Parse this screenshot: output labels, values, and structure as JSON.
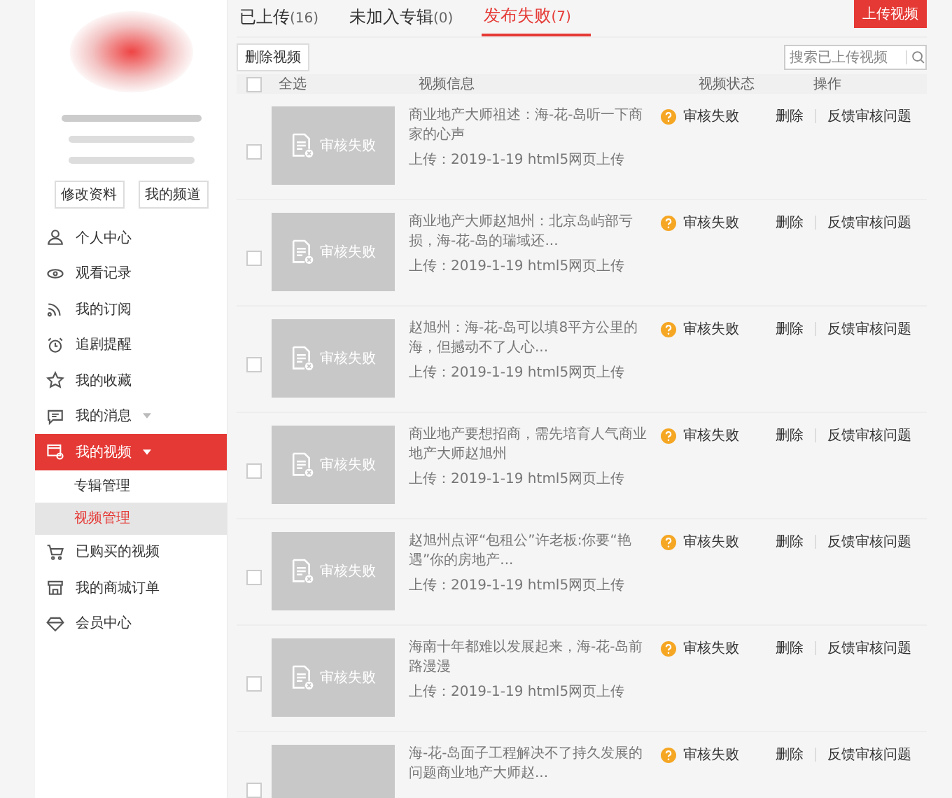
{
  "sidebar": {
    "buttons": [
      "修改资料",
      "我的频道"
    ],
    "items": [
      {
        "kind": "user",
        "label": "个人中心",
        "selected": false
      },
      {
        "kind": "eye",
        "label": "观看记录",
        "selected": false
      },
      {
        "kind": "rss",
        "label": "我的订阅",
        "selected": false
      },
      {
        "kind": "alarm",
        "label": "追剧提醒",
        "selected": false
      },
      {
        "kind": "star",
        "label": "我的收藏",
        "selected": false
      },
      {
        "kind": "message",
        "label": "我的消息",
        "selected": false,
        "caret": true
      },
      {
        "kind": "video",
        "label": "我的视频",
        "selected": true,
        "caret": true,
        "children": [
          {
            "label": "专辑管理",
            "selected": false
          },
          {
            "label": "视频管理",
            "selected": true
          }
        ]
      },
      {
        "kind": "cart",
        "label": "已购买的视频",
        "selected": false
      },
      {
        "kind": "shop",
        "label": "我的商城订单",
        "selected": false
      },
      {
        "kind": "diamond",
        "label": "会员中心",
        "selected": false
      }
    ]
  },
  "tabs": [
    {
      "label": "已上传",
      "count": "(16)",
      "selected": false
    },
    {
      "label": "未加入专辑",
      "count": "(0)",
      "selected": false
    },
    {
      "label": "发布失败",
      "count": "(7)",
      "selected": true
    }
  ],
  "upload_button": "上传视频",
  "delete_button": "删除视频",
  "search": {
    "placeholder": "搜索已上传视频"
  },
  "table": {
    "select_all": {
      "label": "全选",
      "checked": false
    },
    "columns": [
      "视频信息",
      "视频状态",
      "操作"
    ],
    "rows": [
      {
        "checked": false,
        "thumb_label": "审核失败",
        "title": "商业地产大师祖述：海-花-岛听一下商家的心声",
        "upload": "上传：2019-1-19 html5网页上传",
        "status": "审核失败",
        "actions": [
          "删除",
          "反馈审核问题"
        ]
      },
      {
        "checked": false,
        "thumb_label": "审核失败",
        "title": "商业地产大师赵旭州：北京岛屿部亏损，海-花-岛的瑞域还...",
        "upload": "上传：2019-1-19 html5网页上传",
        "status": "审核失败",
        "actions": [
          "删除",
          "反馈审核问题"
        ]
      },
      {
        "checked": false,
        "thumb_label": "审核失败",
        "title": "赵旭州：海-花-岛可以填8平方公里的海，但撼动不了人心...",
        "upload": "上传：2019-1-19 html5网页上传",
        "status": "审核失败",
        "actions": [
          "删除",
          "反馈审核问题"
        ]
      },
      {
        "checked": false,
        "thumb_label": "审核失败",
        "title": "商业地产要想招商，需先培育人气商业地产大师赵旭州",
        "upload": "上传：2019-1-19 html5网页上传",
        "status": "审核失败",
        "actions": [
          "删除",
          "反馈审核问题"
        ]
      },
      {
        "checked": false,
        "thumb_label": "审核失败",
        "title": "赵旭州点评“包租公”许老板:你要“艳遇”你的房地产...",
        "upload": "上传：2019-1-19 html5网页上传",
        "status": "审核失败",
        "actions": [
          "删除",
          "反馈审核问题"
        ]
      },
      {
        "checked": false,
        "thumb_label": "审核失败",
        "title": "海南十年都难以发展起来，海-花-岛前路漫漫",
        "upload": "上传：2019-1-19 html5网页上传",
        "status": "审核失败",
        "actions": [
          "删除",
          "反馈审核问题"
        ]
      },
      {
        "checked": false,
        "title": "海-花-岛面子工程解决不了持久发展的问题商业地产大师赵...",
        "status": "审核失败",
        "actions": [
          "删除",
          "反馈审核问题"
        ]
      }
    ]
  }
}
